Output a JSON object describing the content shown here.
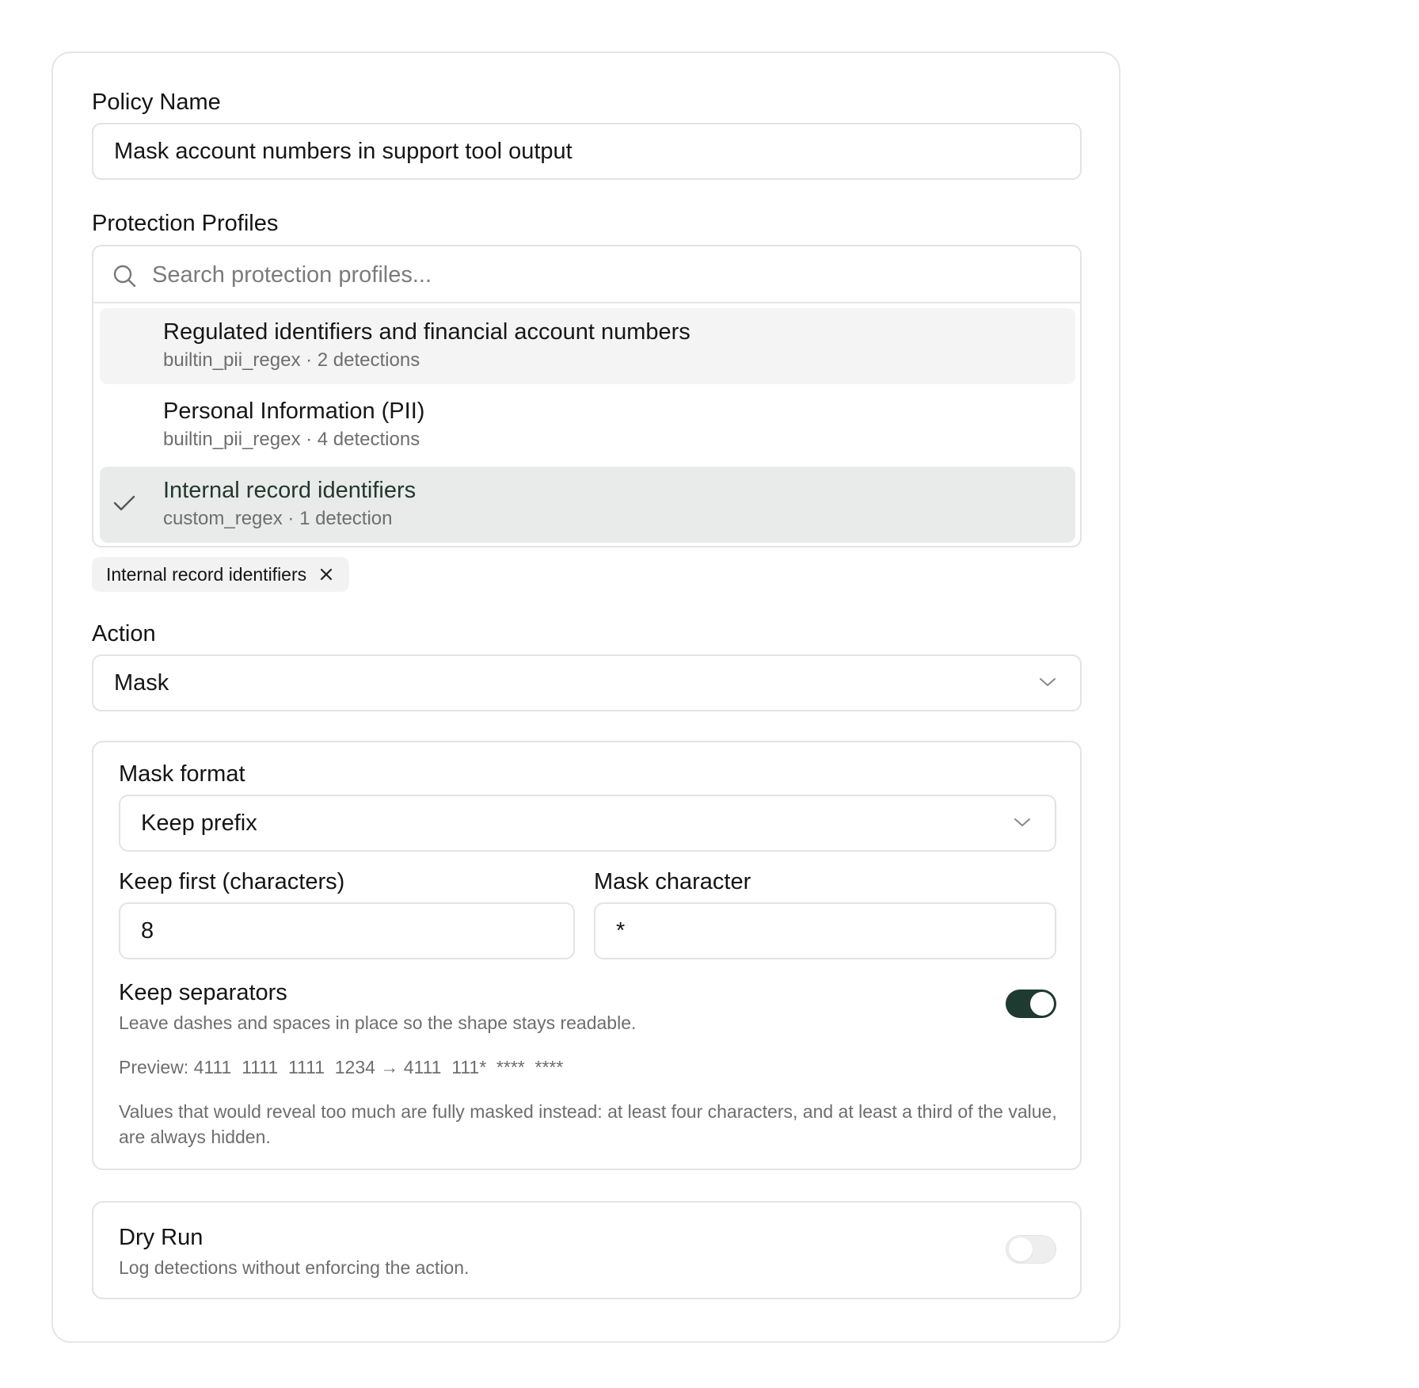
{
  "policy": {
    "label": "Policy Name",
    "value": "Mask account numbers in support tool output"
  },
  "profiles": {
    "label": "Protection Profiles",
    "search_placeholder": "Search protection profiles...",
    "options": [
      {
        "title": "Regulated identifiers and financial account numbers",
        "subtitle": "builtin_pii_regex · 2 detections",
        "selected": false,
        "highlighted": true
      },
      {
        "title": "Personal Information (PII)",
        "subtitle": "builtin_pii_regex · 4 detections",
        "selected": false,
        "highlighted": false
      },
      {
        "title": "Internal record identifiers",
        "subtitle": "custom_regex · 1 detection",
        "selected": true,
        "highlighted": false
      }
    ],
    "chips": [
      {
        "label": "Internal record identifiers"
      }
    ]
  },
  "action": {
    "label": "Action",
    "value": "Mask"
  },
  "mask": {
    "format_label": "Mask format",
    "format_value": "Keep prefix",
    "keep_first_label": "Keep first (characters)",
    "keep_first_value": "8",
    "mask_char_label": "Mask character",
    "mask_char_value": "*",
    "keep_separators_title": "Keep separators",
    "keep_separators_desc": "Leave dashes and spaces in place so the shape stays readable.",
    "keep_separators_on": true,
    "preview": "Preview: 4111  1111  1111  1234 → 4111  111*  ****  ****",
    "note": "Values that would reveal too much are fully masked instead: at least four characters, and at least a third of the value, are always hidden."
  },
  "dry_run": {
    "title": "Dry Run",
    "desc": "Log detections without enforcing the action.",
    "on": false
  },
  "colors": {
    "accent": "#1f3a30",
    "border": "#e3e3e3",
    "muted_text": "#6e6e6e",
    "selected_bg": "#e9ebea"
  },
  "icons": [
    "search-icon",
    "check-icon",
    "close-icon",
    "chevron-down-icon"
  ]
}
